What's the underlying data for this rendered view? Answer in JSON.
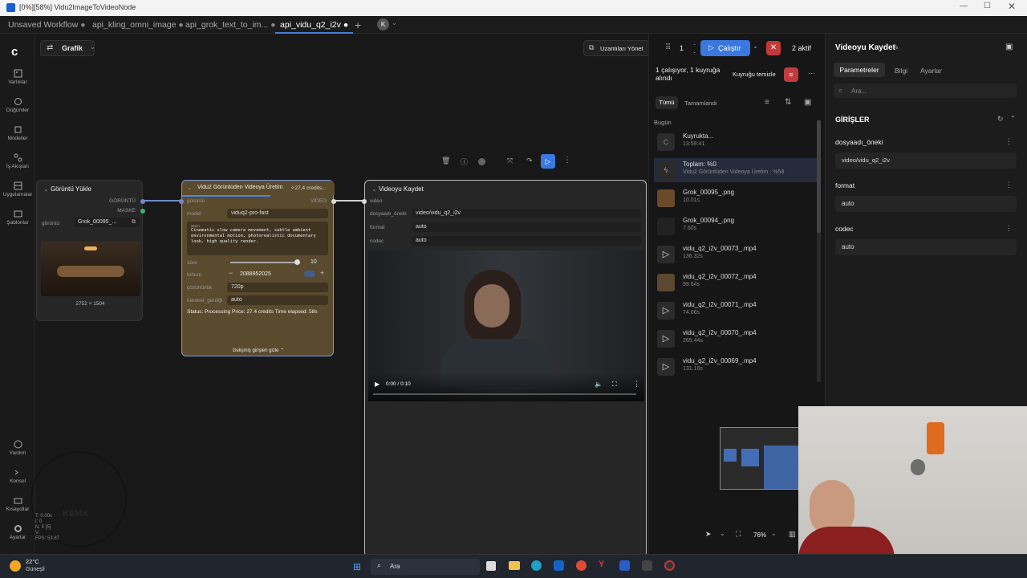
{
  "window": {
    "title": "[0%][58%] Vidu2ImageToVideoNode"
  },
  "tabs": [
    {
      "label": "Unsaved Workflow"
    },
    {
      "label": "api_kling_omni_image"
    },
    {
      "label": "api_grok_text_to_im..."
    },
    {
      "label": "api_vidu_q2_i2v"
    }
  ],
  "user_avatar": "K",
  "sidebar": [
    {
      "label": "Varlıklar",
      "icon": "image-icon"
    },
    {
      "label": "Düğümler",
      "icon": "nodes-icon"
    },
    {
      "label": "Modeller",
      "icon": "cube-icon"
    },
    {
      "label": "İş Akışları",
      "icon": "workflow-icon"
    },
    {
      "label": "Uygulamalar",
      "icon": "apps-icon"
    },
    {
      "label": "Şablonlar",
      "icon": "template-icon"
    },
    {
      "label": "Yardım",
      "icon": "help-icon"
    },
    {
      "label": "Konsol",
      "icon": "terminal-icon"
    },
    {
      "label": "Kısayollar",
      "icon": "keyboard-icon"
    },
    {
      "label": "Ayarlar",
      "icon": "gear-icon"
    }
  ],
  "toolbar": {
    "view_label": "Grafik",
    "extensions_label": "Uzantıları Yönet",
    "count": "1",
    "run_label": "Çalıştır",
    "active_label": "2 aktif"
  },
  "node_toolbar": {
    "colors": [
      "#666666"
    ]
  },
  "nodes": {
    "load_image": {
      "title": "Görüntü Yükle",
      "out_image": "GÖRÜNTÜ",
      "out_mask": "MASKE",
      "field_label": "görüntü",
      "file": "Grok_00095_...",
      "dimensions": "2752 × 1504"
    },
    "vidu": {
      "title": "Vidu2 Görüntüden Videoya Üretim",
      "credits": "27,4 credits...",
      "in_label": "görüntü",
      "out_label": "VIDEO",
      "model_label": "model",
      "model_value": "viduq2-pro-fast",
      "prompt_label": "istem",
      "prompt": "Cinematic slow camera movement, subtle ambient environmental motion, photorealistic documentary look, high quality render.",
      "duration_label": "süre",
      "duration_value": "10",
      "seed_label": "tohum",
      "seed_value": "2088952025",
      "resolution_label": "çözünürlük",
      "resolution_value": "720p",
      "motion_label": "hareket_genliği",
      "motion_value": "auto",
      "status": "Status: Processing Price: 27.4 credits Time elapsed: 58s",
      "advanced_label": "Gelişmiş girişleri gizle",
      "progress": 0.58
    },
    "save_video": {
      "title": "Videoyu Kaydet",
      "in_label": "video",
      "prefix_label": "dosyaadı_öneki",
      "prefix_value": "video/vidu_q2_i2v",
      "format_label": "format",
      "format_value": "auto",
      "codec_label": "codec",
      "codec_value": "auto",
      "time": "0:00 / 0:10"
    }
  },
  "queue": {
    "header": "1 çalışıyor, 1 kuyruğa alındı",
    "clear_label": "Kuyruğu temizle",
    "tab_all": "Tümü",
    "tab_done": "Tamamlandı",
    "section": "Bugün",
    "items": [
      {
        "name": "Kuyrukta...",
        "time": "13:59:41"
      },
      {
        "name": "Toplam: %0",
        "time": "Vidu2 Görüntüden Videoya Üretim : %58"
      },
      {
        "name": "Grok_00095_.png",
        "time": "10.01s"
      },
      {
        "name": "Grok_00094_.png",
        "time": "7.60s"
      },
      {
        "name": "vidu_q2_i2v_00073_.mp4",
        "time": "136.32s"
      },
      {
        "name": "vidu_q2_i2v_00072_.mp4",
        "time": "99.64s"
      },
      {
        "name": "vidu_q2_i2v_00071_.mp4",
        "time": "74.06s"
      },
      {
        "name": "vidu_q2_i2v_00070_.mp4",
        "time": "265.44s"
      },
      {
        "name": "vidu_q2_i2v_00069_.mp4",
        "time": "131.16s"
      }
    ]
  },
  "props": {
    "title": "Videoyu Kaydet",
    "tabs": [
      "Parametreler",
      "Bilgi",
      "Ayarlar"
    ],
    "search_placeholder": "Ara...",
    "section": "GİRİŞLER",
    "fields": [
      {
        "label": "dosyaadı_öneki",
        "value": "video/vidu_q2_i2v"
      },
      {
        "label": "format",
        "value": "auto"
      },
      {
        "label": "codec",
        "value": "auto"
      }
    ]
  },
  "bottom": {
    "zoom": "76%"
  },
  "stats": {
    "line1": "T: 0.00s",
    "line2": "I: 0",
    "line3": "N: 5 [5]",
    "line4": "V: ",
    "line5": "FPS: 53.87"
  },
  "watermark": "KEMX",
  "taskbar": {
    "weather_temp": "22°C",
    "weather_desc": "Güneşli",
    "search": "Ara"
  }
}
